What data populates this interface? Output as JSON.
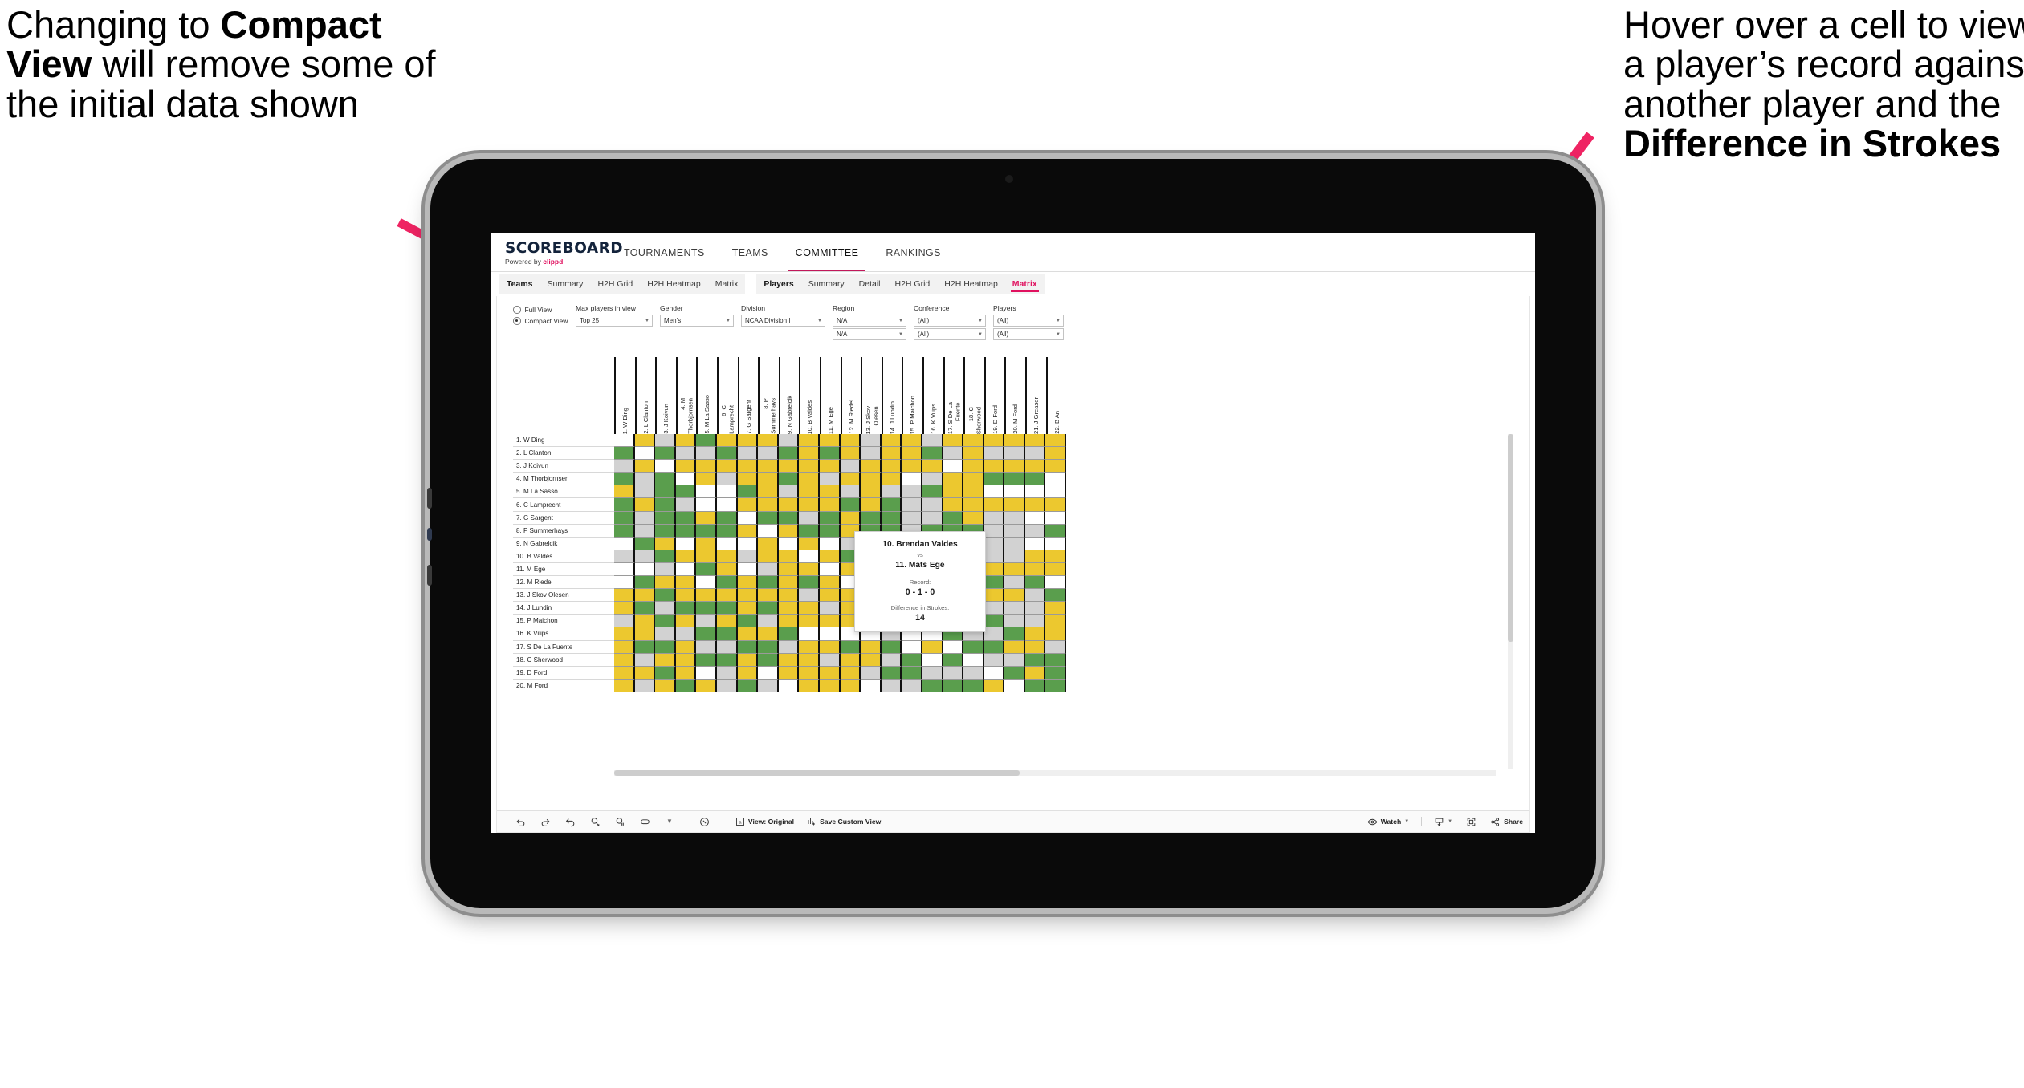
{
  "annotations": {
    "left": {
      "pre": "Changing to ",
      "bold": "Compact View",
      "post": " will remove some of the initial data shown"
    },
    "right": {
      "pre": "Hover over a cell to view a player’s record against another player and the ",
      "bold": "Difference in Strokes",
      "post": ""
    },
    "arrow_color": "#ef2463"
  },
  "app": {
    "brand": {
      "word": "SCOREBOARD",
      "powered_pre": "Powered by ",
      "powered_brand": "clippd"
    },
    "topnav": [
      {
        "label": "TOURNAMENTS",
        "active": false
      },
      {
        "label": "TEAMS",
        "active": false
      },
      {
        "label": "COMMITTEE",
        "active": true
      },
      {
        "label": "RANKINGS",
        "active": false
      }
    ],
    "subnav_teams": [
      {
        "label": "Teams",
        "head": true
      },
      {
        "label": "Summary"
      },
      {
        "label": "H2H Grid"
      },
      {
        "label": "H2H Heatmap"
      },
      {
        "label": "Matrix"
      }
    ],
    "subnav_players": [
      {
        "label": "Players",
        "head": true
      },
      {
        "label": "Summary"
      },
      {
        "label": "Detail"
      },
      {
        "label": "H2H Grid"
      },
      {
        "label": "H2H Heatmap"
      },
      {
        "label": "Matrix",
        "selected": true
      }
    ],
    "accent": "#e0115f"
  },
  "filters": {
    "view_options": [
      {
        "label": "Full View",
        "selected": false
      },
      {
        "label": "Compact View",
        "selected": true
      }
    ],
    "groups": [
      {
        "label": "Max players in view",
        "values": [
          "Top 25"
        ],
        "width_class": "w-mp"
      },
      {
        "label": "Gender",
        "values": [
          "Men’s"
        ],
        "width_class": "w-gd"
      },
      {
        "label": "Division",
        "values": [
          "NCAA Division I"
        ],
        "width_class": "w-dv"
      },
      {
        "label": "Region",
        "values": [
          "N/A",
          "N/A"
        ],
        "width_class": "w-rg"
      },
      {
        "label": "Conference",
        "values": [
          "(All)",
          "(All)"
        ],
        "width_class": "w-cf"
      },
      {
        "label": "Players",
        "values": [
          "(All)",
          "(All)"
        ],
        "width_class": "w-pl"
      }
    ]
  },
  "matrix": {
    "row_labels": [
      "1. W Ding",
      "2. L Clanton",
      "3. J Koivun",
      "4. M Thorbjornsen",
      "5. M La Sasso",
      "6. C Lamprecht",
      "7. G Sargent",
      "8. P Summerhays",
      "9. N Gabrelcik",
      "10. B Valdes",
      "11. M Ege",
      "12. M Riedel",
      "13. J Skov Olesen",
      "14. J Lundin",
      "15. P Maichon",
      "16. K Vilips",
      "17. S De La Fuente",
      "18. C Sherwood",
      "19. D Ford",
      "20. M Ford"
    ],
    "col_labels": [
      "1. W Ding",
      "2. L Clanton",
      "3. J Koivun",
      "4. M\nThorbjornsen",
      "5. M La Sasso",
      "6. C\nLamprecht",
      "7. G Sargent",
      "8. P\nSummerhays",
      "9. N Gabrelcik",
      "10. B Valdes",
      "11. M Ege",
      "12. M Riedel",
      "13. J Skov\nOlesen",
      "14. J Lundin",
      "15. P Maichon",
      "16. K Vilips",
      "17. S De La\nFuente",
      "18. C\nSherwood",
      "19. D Ford",
      "20. M Ford",
      "21. J Greaser",
      "22. B An"
    ],
    "legend_colors": {
      "win": "#5a9e4d",
      "tie": "#ecc82f",
      "loss": "#d2d2d2",
      "none": "#ffffff"
    },
    "cells": [
      [
        "n",
        "y",
        "g",
        "y",
        "v",
        "y",
        "y",
        "y",
        "g",
        "y",
        "y",
        "y",
        "g",
        "y",
        "y",
        "g",
        "y",
        "y",
        "y",
        "y",
        "y",
        "y"
      ],
      [
        "v",
        "n",
        "v",
        "g",
        "g",
        "v",
        "g",
        "g",
        "v",
        "y",
        "v",
        "y",
        "g",
        "y",
        "y",
        "v",
        "g",
        "y",
        "g",
        "g",
        "g",
        "y"
      ],
      [
        "g",
        "y",
        "n",
        "y",
        "y",
        "y",
        "y",
        "y",
        "y",
        "y",
        "y",
        "g",
        "y",
        "y",
        "y",
        "y",
        "n",
        "y",
        "y",
        "y",
        "y",
        "y"
      ],
      [
        "v",
        "g",
        "v",
        "n",
        "y",
        "g",
        "y",
        "y",
        "v",
        "y",
        "g",
        "y",
        "y",
        "y",
        "n",
        "g",
        "y",
        "y",
        "v",
        "v",
        "v",
        "n"
      ],
      [
        "y",
        "g",
        "v",
        "v",
        "n",
        "n",
        "v",
        "y",
        "g",
        "y",
        "y",
        "g",
        "y",
        "g",
        "g",
        "v",
        "y",
        "y",
        "n",
        "n",
        "n",
        "n"
      ],
      [
        "v",
        "y",
        "v",
        "g",
        "n",
        "n",
        "y",
        "y",
        "y",
        "y",
        "y",
        "v",
        "y",
        "v",
        "g",
        "g",
        "y",
        "y",
        "y",
        "y",
        "y",
        "y"
      ],
      [
        "v",
        "g",
        "v",
        "v",
        "y",
        "v",
        "n",
        "v",
        "v",
        "g",
        "v",
        "y",
        "v",
        "v",
        "g",
        "g",
        "v",
        "y",
        "g",
        "g",
        "n",
        "n"
      ],
      [
        "v",
        "g",
        "v",
        "v",
        "v",
        "v",
        "y",
        "n",
        "y",
        "v",
        "v",
        "y",
        "v",
        "v",
        "g",
        "v",
        "v",
        "v",
        "g",
        "g",
        "g",
        "v"
      ],
      [
        "n",
        "v",
        "y",
        "n",
        "y",
        "n",
        "n",
        "y",
        "n",
        "y",
        "n",
        "g",
        "y",
        "y",
        "n",
        "n",
        "y",
        "y",
        "g",
        "g",
        "n",
        "n"
      ],
      [
        "g",
        "g",
        "v",
        "y",
        "y",
        "y",
        "g",
        "y",
        "y",
        "n",
        "y",
        "v",
        "y",
        "y",
        "n",
        "y",
        "n",
        "v",
        "g",
        "g",
        "y",
        "y"
      ],
      [
        "n",
        "n",
        "g",
        "n",
        "v",
        "y",
        "n",
        "g",
        "y",
        "y",
        "n",
        "y",
        "g",
        "n",
        "n",
        "n",
        "y",
        "y",
        "y",
        "y",
        "y",
        "y"
      ],
      [
        "n",
        "v",
        "y",
        "y",
        "n",
        "v",
        "y",
        "v",
        "y",
        "v",
        "y",
        "n",
        "y",
        "y",
        "v",
        "g",
        "g",
        "y",
        "v",
        "g",
        "v",
        "n"
      ],
      [
        "y",
        "y",
        "v",
        "y",
        "y",
        "y",
        "y",
        "y",
        "y",
        "g",
        "y",
        "y",
        "n",
        "y",
        "y",
        "n",
        "y",
        "g",
        "y",
        "y",
        "g",
        "v"
      ],
      [
        "y",
        "v",
        "g",
        "v",
        "v",
        "v",
        "y",
        "v",
        "y",
        "y",
        "g",
        "y",
        "y",
        "n",
        "g",
        "g",
        "y",
        "g",
        "g",
        "g",
        "g",
        "y"
      ],
      [
        "g",
        "y",
        "v",
        "y",
        "g",
        "y",
        "v",
        "g",
        "y",
        "y",
        "y",
        "y",
        "y",
        "g",
        "n",
        "n",
        "y",
        "v",
        "v",
        "g",
        "g",
        "y"
      ],
      [
        "y",
        "y",
        "g",
        "g",
        "v",
        "v",
        "y",
        "y",
        "v",
        "n",
        "n",
        "n",
        "n",
        "g",
        "n",
        "n",
        "v",
        "g",
        "g",
        "v",
        "y",
        "y"
      ],
      [
        "y",
        "v",
        "v",
        "y",
        "g",
        "g",
        "v",
        "v",
        "g",
        "y",
        "y",
        "v",
        "y",
        "v",
        "n",
        "y",
        "n",
        "v",
        "v",
        "y",
        "y",
        "g"
      ],
      [
        "y",
        "g",
        "y",
        "y",
        "v",
        "v",
        "y",
        "v",
        "y",
        "y",
        "g",
        "y",
        "y",
        "g",
        "v",
        "n",
        "v",
        "n",
        "g",
        "g",
        "v",
        "v"
      ],
      [
        "y",
        "y",
        "v",
        "y",
        "n",
        "g",
        "y",
        "n",
        "y",
        "y",
        "y",
        "y",
        "g",
        "v",
        "v",
        "g",
        "g",
        "g",
        "n",
        "v",
        "y",
        "v"
      ],
      [
        "y",
        "g",
        "y",
        "v",
        "y",
        "g",
        "v",
        "g",
        "n",
        "y",
        "y",
        "y",
        "n",
        "g",
        "g",
        "v",
        "v",
        "v",
        "y",
        "n",
        "v",
        "v"
      ]
    ]
  },
  "tooltip": {
    "player_a": "10. Brendan Valdes",
    "vs": "vs",
    "player_b": "11. Mats Ege",
    "record_label": "Record:",
    "record_value": "0 - 1 - 0",
    "diff_label": "Difference in Strokes:",
    "diff_value": "14"
  },
  "toolbar": {
    "icons": [
      "undo-icon",
      "redo-icon",
      "revert-icon",
      "refresh-icon",
      "pause-icon",
      "slower-icon",
      "caret-icon",
      "help-icon"
    ],
    "view_label": "View: Original",
    "save_label": "Save Custom View",
    "watch_label": "Watch",
    "share_label": "Share"
  }
}
